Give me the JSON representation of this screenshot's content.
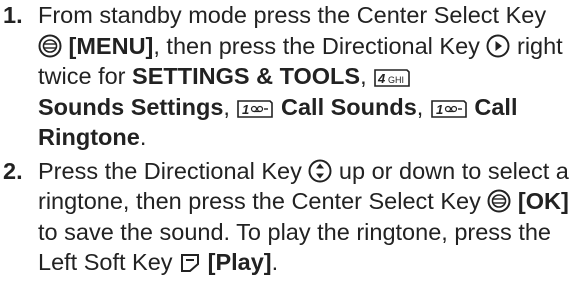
{
  "steps": [
    {
      "number": "1.",
      "t1": "From standby mode press the Center Select Key",
      "menu": "[MENU]",
      "t2": ", then press the Directional Key",
      "t3": "right twice for",
      "settings_tools": "SETTINGS & TOOLS",
      "sep1": ",",
      "key4_label": "4 GHI",
      "sounds_settings": "Sounds Settings",
      "sep2": ",",
      "key1_label": "1",
      "call_sounds": "Call Sounds",
      "sep3": ",",
      "call_ringtone": "Call Ringtone",
      "end": "."
    },
    {
      "number": "2.",
      "t1": "Press the Directional Key",
      "t2": "up or down to select a ringtone, then press the Center Select Key",
      "ok": "[OK]",
      "t3": "to save the sound. To play the ringtone, press the Left Soft Key",
      "play": "[Play]",
      "end": "."
    }
  ],
  "icons": {
    "center_select": "center-select-key-icon",
    "directional_right": "directional-right-icon",
    "directional_updown": "directional-up-down-icon",
    "key4": "key-4-ghi-icon",
    "key1": "key-1-voicemail-icon",
    "left_soft": "left-soft-key-icon"
  }
}
